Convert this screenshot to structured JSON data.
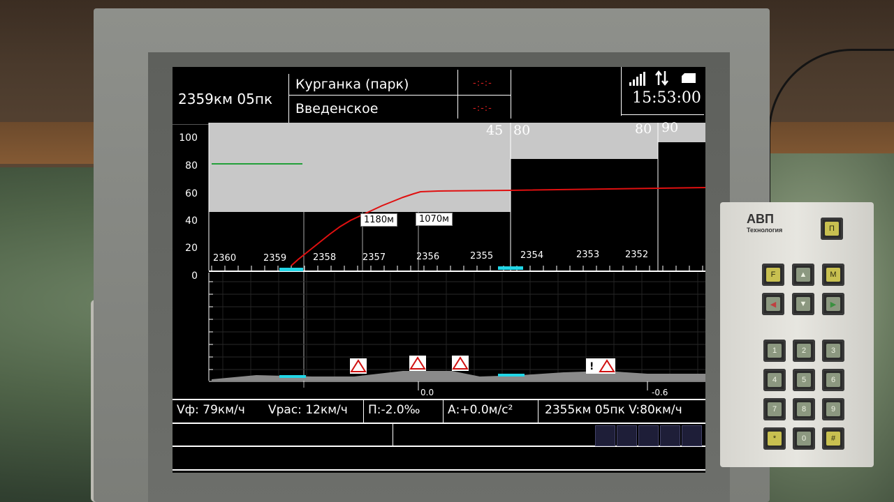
{
  "header": {
    "location": "2359км 05пк",
    "station_1": "Курганка (парк)",
    "station_2": "Введенское",
    "station_1_indicator": "-:-:-",
    "station_2_indicator": "-:-:-",
    "clock": "15:53:00",
    "icons": [
      "signal-strength-icon",
      "data-transfer-icon",
      "card-icon"
    ]
  },
  "chart": {
    "y_ticks": [
      "100",
      "80",
      "60",
      "40",
      "20",
      "0"
    ],
    "km_markers": [
      "2360",
      "2359",
      "2358",
      "2357",
      "2356",
      "2355",
      "2354",
      "2353",
      "2352"
    ],
    "speed_limit_labels": [
      "45",
      "80",
      "80",
      "90"
    ],
    "distance_tags": [
      "1180м",
      "1070м"
    ],
    "gradient_labels": [
      "0.0",
      "-0.6"
    ]
  },
  "chart_data": {
    "type": "line",
    "ylim": [
      0,
      100
    ],
    "series": [],
    "speed_limit_steps": [
      45,
      80,
      90
    ],
    "actual_speed_level": 80,
    "target_curve_final": 60
  },
  "footer": {
    "vf": "Vф: 79км/ч",
    "vras": "Vрас: 12км/ч",
    "grade": "П:-2.0‰",
    "accel": "А:+0.0м/с²",
    "next": "2355км 05пк V:80км/ч"
  },
  "keypad": {
    "logo": "АВП",
    "logo_sub": "Технология",
    "p_key": "П",
    "f_key": "F",
    "m_key": "M",
    "digits": [
      "1",
      "2",
      "3",
      "4",
      "5",
      "6",
      "7",
      "8",
      "9"
    ],
    "star": "*",
    "zero": "0",
    "hash": "#"
  },
  "colors": {
    "limit_fill": "#c8c8c8",
    "actual_speed": "#22a03a",
    "target_curve": "#e01010",
    "station_marker": "#22d6e6",
    "status_block": "#1e1e38"
  }
}
